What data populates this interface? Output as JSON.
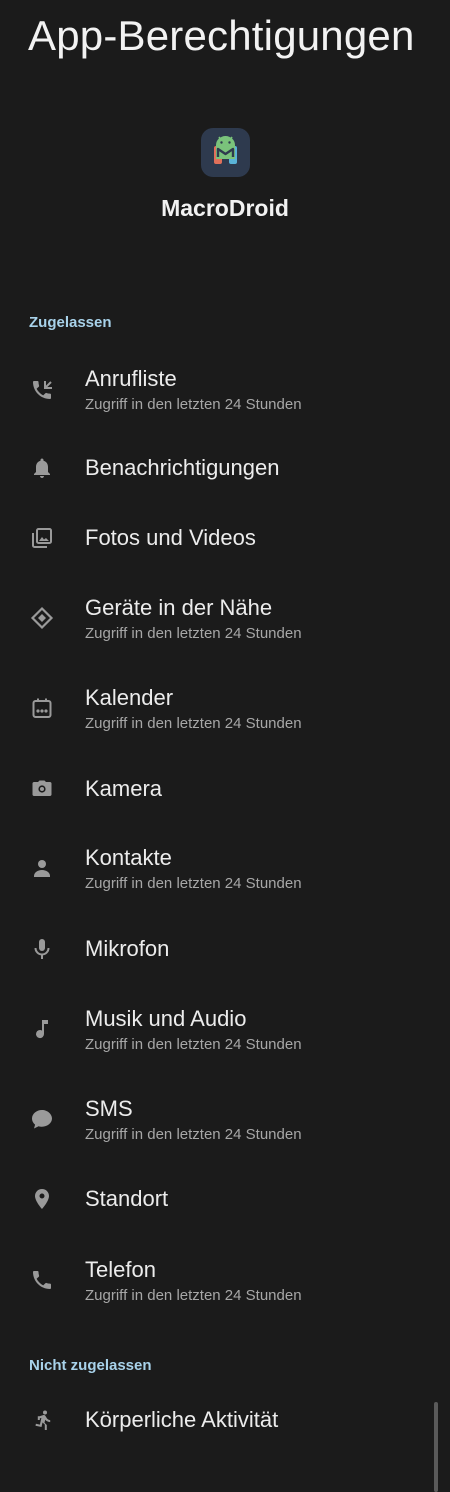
{
  "header": {
    "title": "App-Berechtigungen"
  },
  "app": {
    "name": "MacroDroid",
    "icon": "android-robot-icon"
  },
  "colors": {
    "background": "#1b1b1b",
    "accent": "#a8d2ea",
    "icon": "#9a9a9a"
  },
  "sections": {
    "allowed": {
      "label": "Zugelassen",
      "items": [
        {
          "title": "Anrufliste",
          "subtitle": "Zugriff in den letzten 24 Stunden",
          "icon": "call-log-icon"
        },
        {
          "title": "Benachrichtigungen",
          "subtitle": "",
          "icon": "bell-icon"
        },
        {
          "title": "Fotos und Videos",
          "subtitle": "",
          "icon": "photo-library-icon"
        },
        {
          "title": "Geräte in der Nähe",
          "subtitle": "Zugriff in den letzten 24 Stunden",
          "icon": "nearby-devices-icon"
        },
        {
          "title": "Kalender",
          "subtitle": "Zugriff in den letzten 24 Stunden",
          "icon": "calendar-icon"
        },
        {
          "title": "Kamera",
          "subtitle": "",
          "icon": "camera-icon"
        },
        {
          "title": "Kontakte",
          "subtitle": "Zugriff in den letzten 24 Stunden",
          "icon": "person-icon"
        },
        {
          "title": "Mikrofon",
          "subtitle": "",
          "icon": "microphone-icon"
        },
        {
          "title": "Musik und Audio",
          "subtitle": "Zugriff in den letzten 24 Stunden",
          "icon": "music-note-icon"
        },
        {
          "title": "SMS",
          "subtitle": "Zugriff in den letzten 24 Stunden",
          "icon": "chat-bubble-icon"
        },
        {
          "title": "Standort",
          "subtitle": "",
          "icon": "location-pin-icon"
        },
        {
          "title": "Telefon",
          "subtitle": "Zugriff in den letzten 24 Stunden",
          "icon": "phone-icon"
        }
      ]
    },
    "denied": {
      "label": "Nicht zugelassen",
      "items": [
        {
          "title": "Körperliche Aktivität",
          "subtitle": "",
          "icon": "running-person-icon"
        }
      ]
    }
  }
}
